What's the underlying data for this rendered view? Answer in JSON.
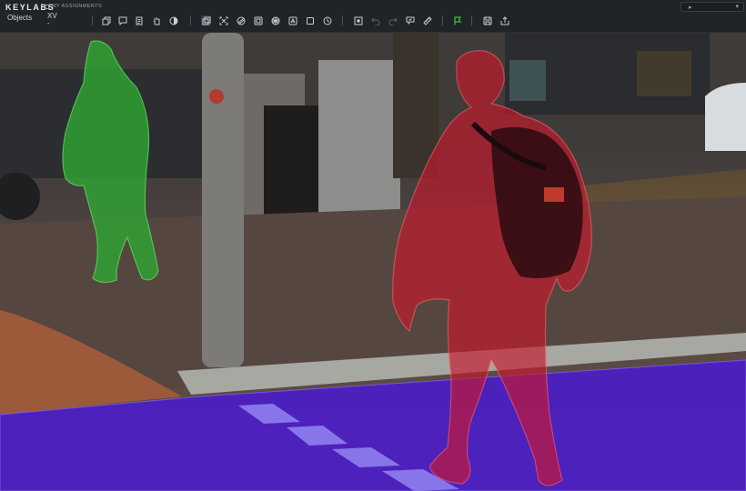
{
  "app": {
    "brand": "KEYLABS",
    "assignments_link": "MY ASSIGNMENTS",
    "objects_label": "Objects",
    "xv_label": "XV",
    "xv_value": "-"
  },
  "toolbar": {
    "groups": [
      [
        "copy-icon",
        "comment-icon",
        "document-icon",
        "hand-icon",
        "contrast-icon"
      ],
      [
        "select-icon",
        "transform-icon",
        "brush-icon",
        "polygon-icon",
        "mask-icon",
        "ai-select-icon",
        "box-icon",
        "timer-icon"
      ],
      [
        "frame-icon",
        "undo-icon",
        "redo-icon",
        "like-icon",
        "ruler-icon"
      ],
      [
        "flag-icon"
      ],
      [
        "save-icon",
        "export-icon"
      ]
    ],
    "active_tool": "select-icon",
    "disabled_tools": [
      "undo-icon",
      "redo-icon"
    ]
  },
  "annotations": [
    {
      "label": "pedestrian-distant",
      "color": "#2fa733",
      "opacity": 0.78
    },
    {
      "label": "pedestrian-near",
      "color": "#c8182d",
      "opacity": 0.62
    },
    {
      "label": "road",
      "color": "#4a18d6",
      "opacity": 0.8
    }
  ],
  "colors": {
    "accent_green": "#3ec24b",
    "toolbar_bg": "#202328"
  }
}
